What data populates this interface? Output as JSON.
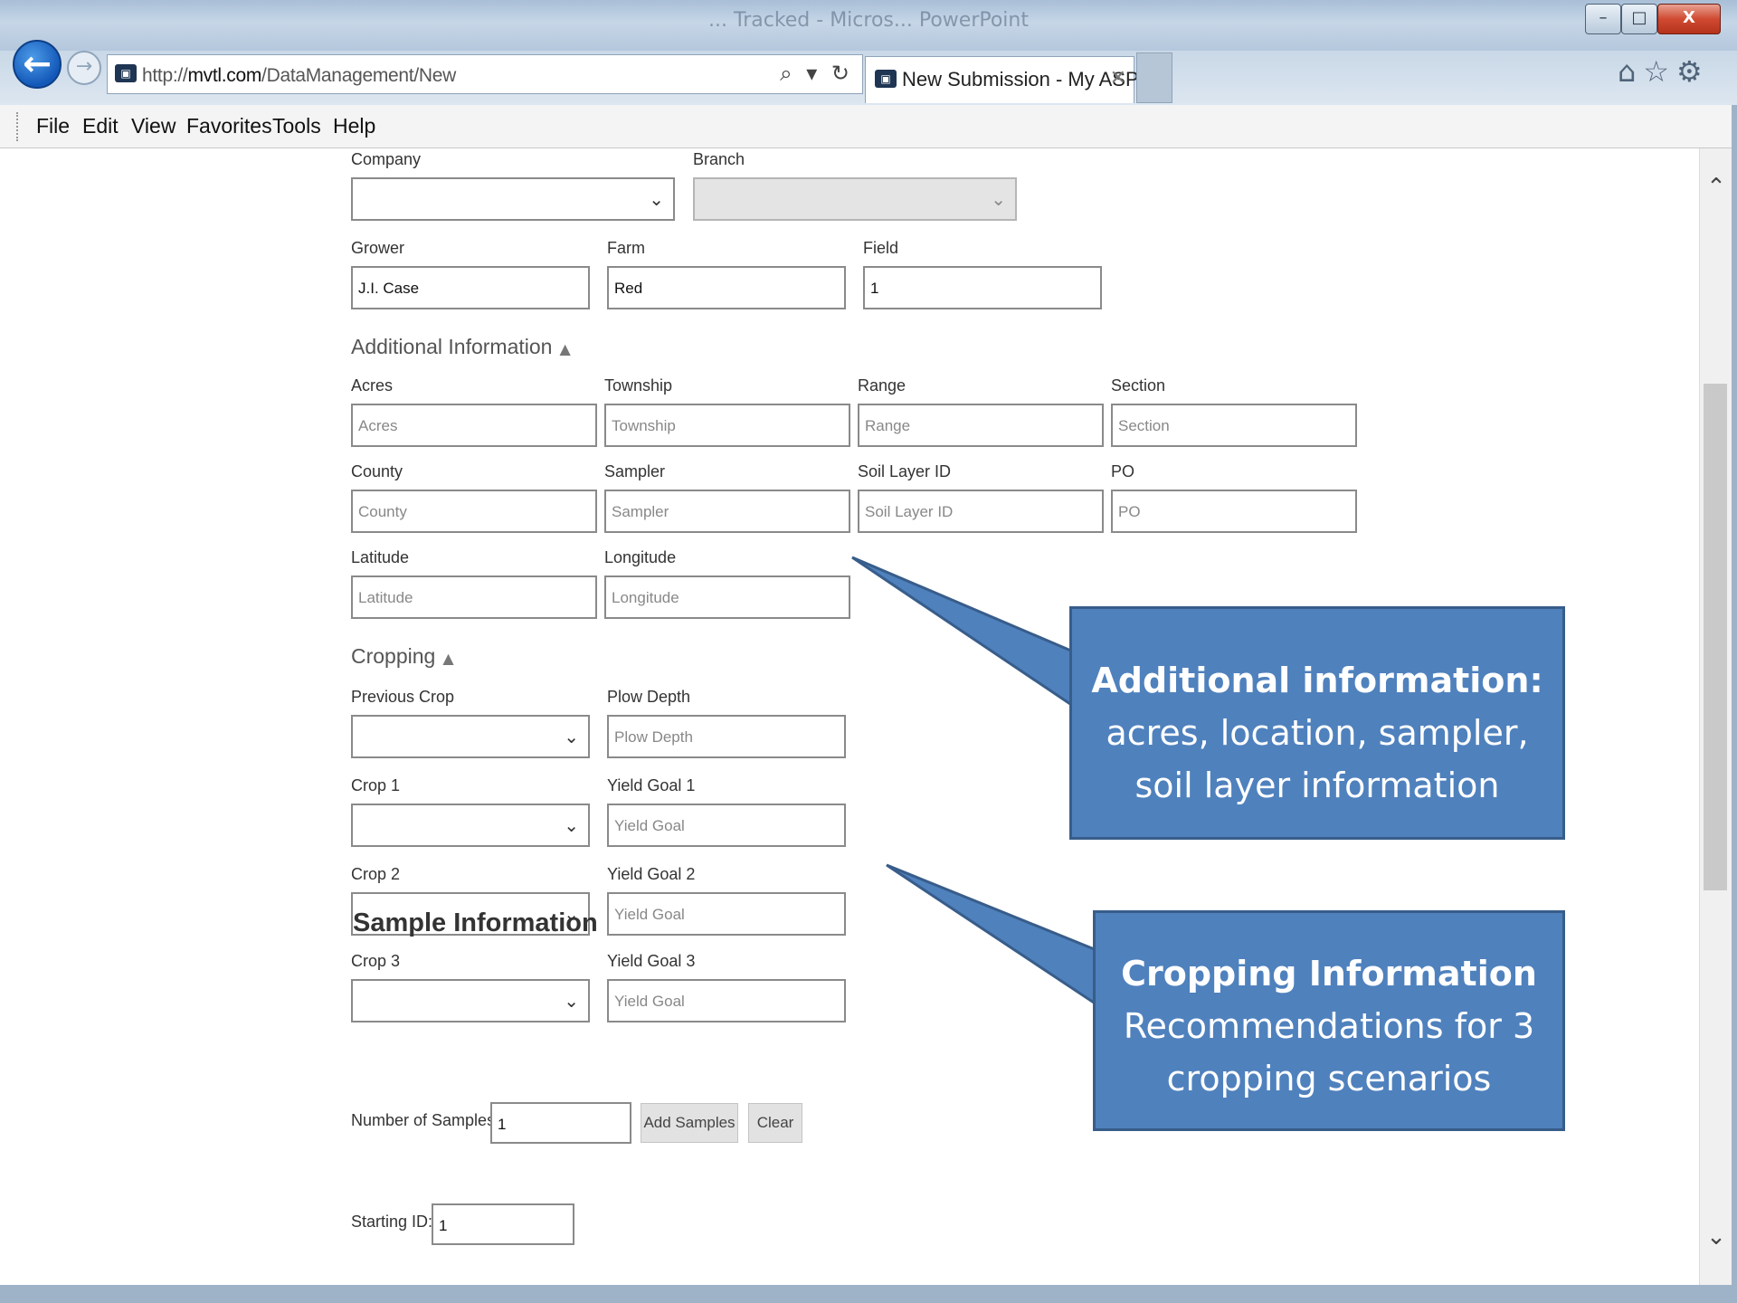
{
  "window": {
    "title": "... Tracked - Micros... PowerPoint",
    "minimize": "–",
    "maximize": "□",
    "close": "X"
  },
  "browser": {
    "url_prefix": "http://",
    "url_domain": "mvtl.com",
    "url_path": "/DataManagement/New",
    "tab_title": "New Submission - My ASP....",
    "tab_close": "✕",
    "address_icons": "⌕ ▾ ↻"
  },
  "menu": [
    "File",
    "Edit",
    "View",
    "Favorites",
    "Tools",
    "Help"
  ],
  "form": {
    "company_label": "Company",
    "branch_label": "Branch",
    "grower_label": "Grower",
    "grower_value": "J.I. Case",
    "farm_label": "Farm",
    "farm_value": "Red",
    "field_label": "Field",
    "field_value": "1",
    "additional_heading": "Additional Information",
    "acres_label": "Acres",
    "acres_ph": "Acres",
    "township_label": "Township",
    "township_ph": "Township",
    "range_label": "Range",
    "range_ph": "Range",
    "section_label": "Section",
    "section_ph": "Section",
    "county_label": "County",
    "county_ph": "County",
    "sampler_label": "Sampler",
    "sampler_ph": "Sampler",
    "soil_label": "Soil Layer ID",
    "soil_ph": "Soil Layer ID",
    "po_label": "PO",
    "po_ph": "PO",
    "latitude_label": "Latitude",
    "latitude_ph": "Latitude",
    "longitude_label": "Longitude",
    "longitude_ph": "Longitude",
    "cropping_heading": "Cropping",
    "prev_crop_label": "Previous Crop",
    "plow_label": "Plow Depth",
    "plow_ph": "Plow Depth",
    "crop1_label": "Crop 1",
    "yield1_label": "Yield Goal 1",
    "crop2_label": "Crop 2",
    "yield2_label": "Yield Goal 2",
    "crop3_label": "Crop 3",
    "yield3_label": "Yield Goal 3",
    "yield_ph": "Yield Goal",
    "sample_heading": "Sample Information",
    "num_samples_label": "Number of Samples:",
    "num_samples_value": "1",
    "add_samples": "Add Samples",
    "clear": "Clear",
    "starting_id_label": "Starting ID:",
    "starting_id_value": "1"
  },
  "callouts": {
    "c1_title": "Additional information:",
    "c1_body": "acres, location, sampler, soil layer information",
    "c2_title": "Cropping Information",
    "c2_body": "Recommendations for 3 cropping scenarios"
  },
  "colors": {
    "callout_fill": "#4f81bd",
    "callout_border": "#385d8a",
    "back_button": "#1358b8"
  }
}
